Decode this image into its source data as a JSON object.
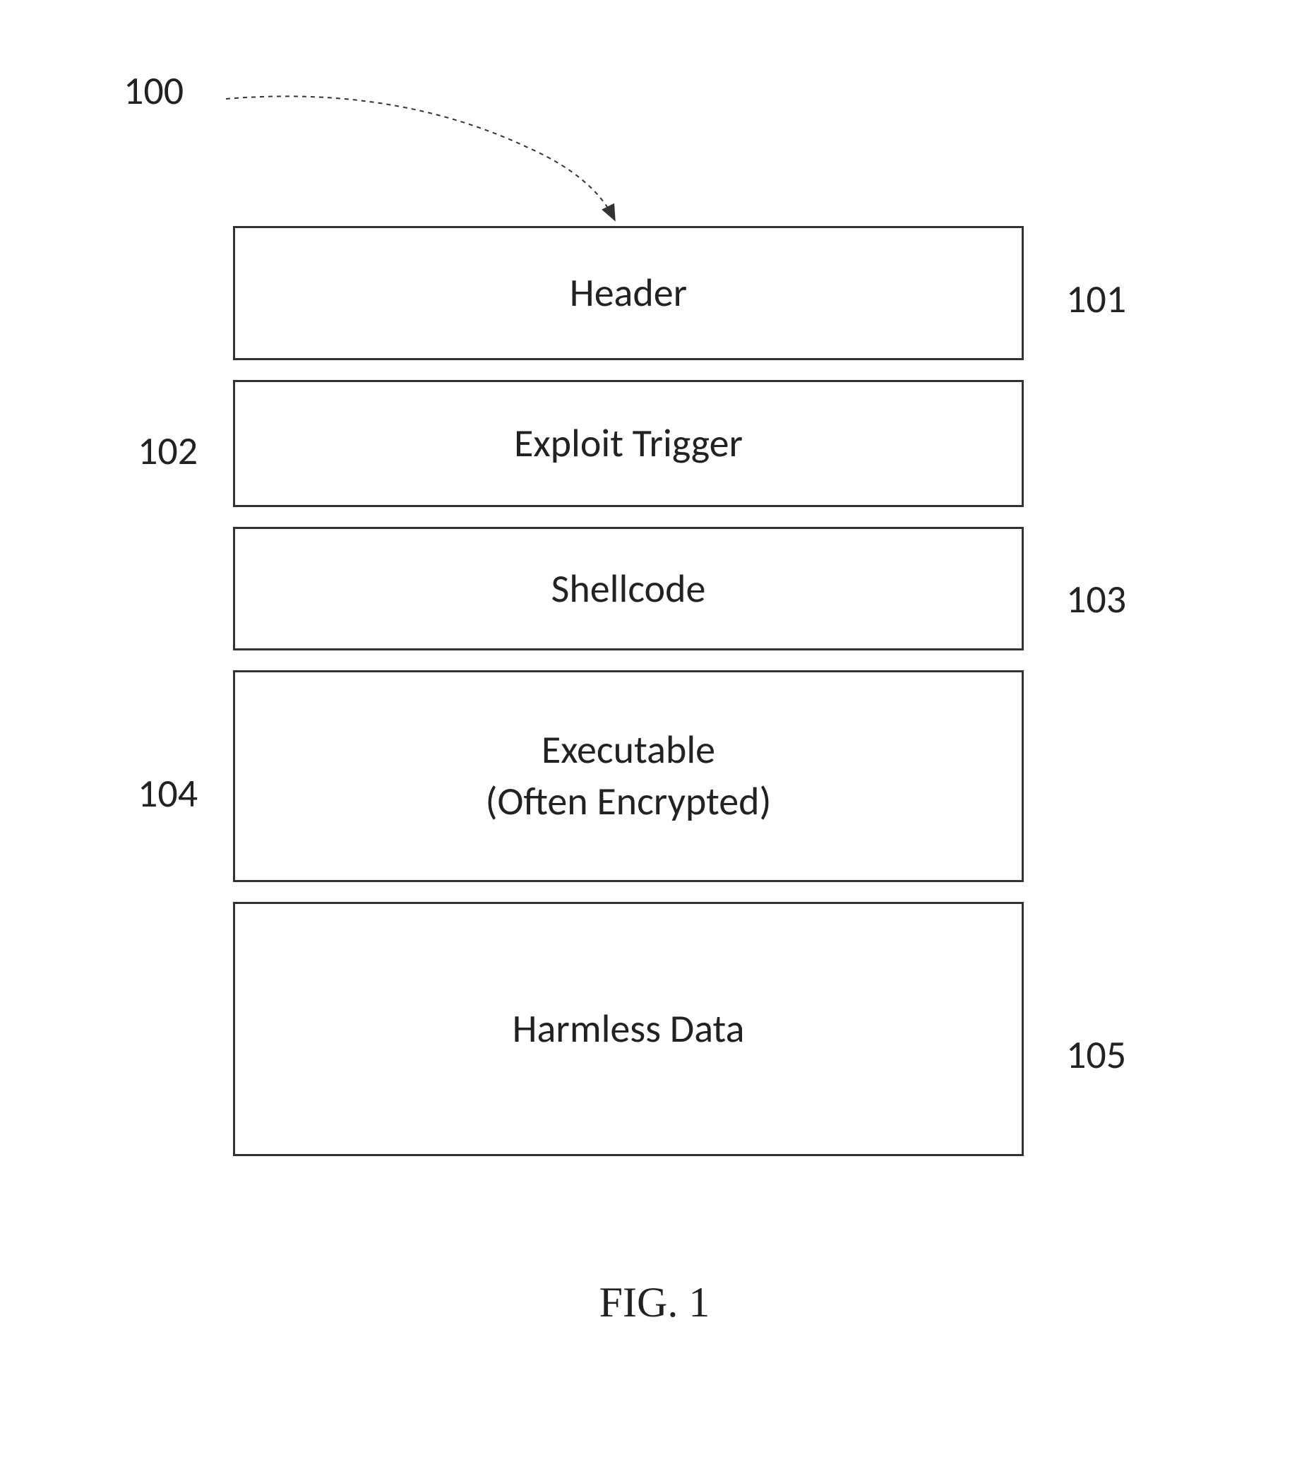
{
  "refs": {
    "r100": "100",
    "r101": "101",
    "r102": "102",
    "r103": "103",
    "r104": "104",
    "r105": "105"
  },
  "blocks": {
    "header": "Header",
    "exploit": "Exploit Trigger",
    "shellcode": "Shellcode",
    "executable_line1": "Executable",
    "executable_line2": "(Often Encrypted)",
    "harmless": "Harmless Data"
  },
  "caption": "FIG. 1"
}
